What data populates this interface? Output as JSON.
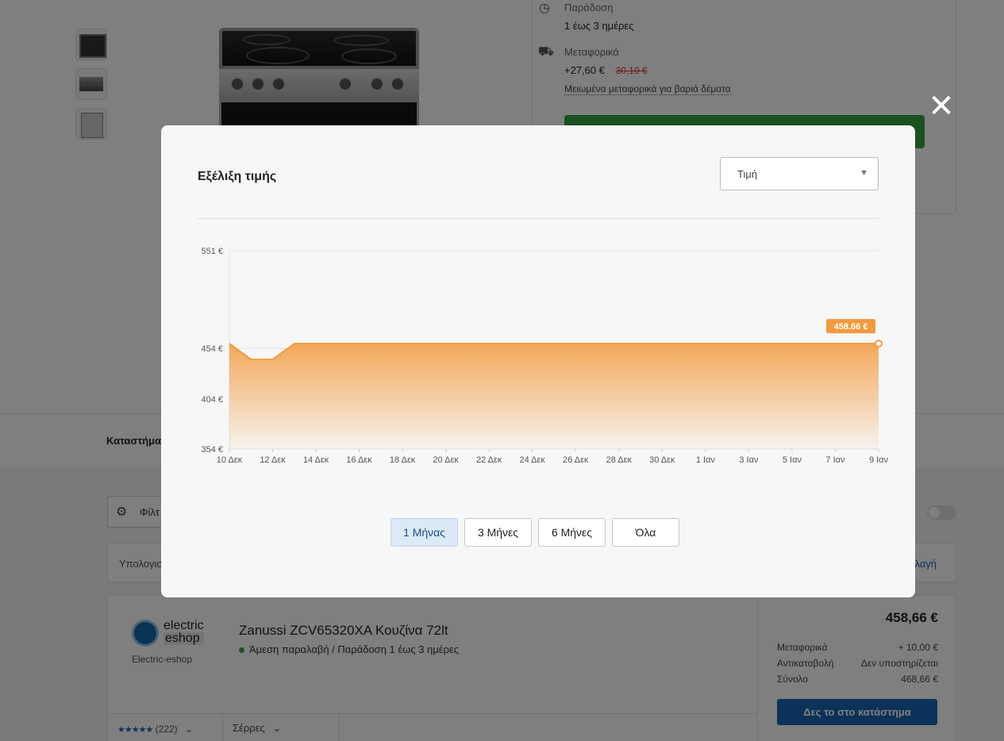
{
  "background": {
    "delivery": {
      "label": "Παράδοση",
      "value": "1 έως 3 ημέρες"
    },
    "shipping": {
      "label": "Μεταφορικά",
      "price": "+27,60 €",
      "old_price": "30,10 €",
      "link": "Μειωμένα μεταφορικά για βαριά δέματα"
    },
    "stores_tab": "Καταστήμα",
    "filter_label": "Φίλτ",
    "calc_label": "Υπολογισ",
    "calc_link": "λαγή"
  },
  "offer": {
    "shop_logo_line1": "electric",
    "shop_logo_line2": "eshop",
    "shop_name": "Electric-eshop",
    "title": "Zanussi ZCV65320XA Κουζίνα 72lt",
    "availability": "Άμεση παραλαβή / Παράδοση 1 έως 3 ημέρες",
    "stars": "★★★★★",
    "review_count": "(222)",
    "city": "Σέρρες",
    "price": "458,66 €",
    "shipping_label": "Μεταφορικά",
    "shipping_value": "+ 10,00 €",
    "cod_label": "Αντικαταβολή",
    "cod_value": "Δεν υποστηρίζεται",
    "total_label": "Σύνολο",
    "total_value": "468,66 €",
    "store_button": "Δες το στο κατάστημα"
  },
  "modal": {
    "title": "Εξέλιξη τιμής",
    "metric_select": "Τιμή",
    "close_symbol": "✕",
    "range_buttons": [
      "1 Μήνας",
      "3 Μήνες",
      "6 Μήνες",
      "Όλα"
    ],
    "active_range": 0
  },
  "chart_data": {
    "type": "area",
    "title": "Εξέλιξη τιμής",
    "y_ticks": [
      354,
      404,
      454,
      551
    ],
    "y_tick_labels": [
      "354 €",
      "404 €",
      "454 €",
      "551 €"
    ],
    "ylim": [
      354,
      551
    ],
    "x_tick_labels": [
      "10 Δεκ",
      "12 Δεκ",
      "14 Δεκ",
      "16 Δεκ",
      "18 Δεκ",
      "20 Δεκ",
      "22 Δεκ",
      "24 Δεκ",
      "26 Δεκ",
      "28 Δεκ",
      "30 Δεκ",
      "1 Ιαν",
      "3 Ιαν",
      "5 Ιαν",
      "7 Ιαν",
      "9 Ιαν"
    ],
    "series": [
      {
        "x": [
          "10 Δεκ",
          "11 Δεκ",
          "12 Δεκ",
          "13 Δεκ",
          "14 Δεκ",
          "16 Δεκ",
          "18 Δεκ",
          "20 Δεκ",
          "22 Δεκ",
          "24 Δεκ",
          "26 Δεκ",
          "28 Δεκ",
          "30 Δεκ",
          "1 Ιαν",
          "3 Ιαν",
          "5 Ιαν",
          "7 Ιαν",
          "9 Ιαν"
        ],
        "values": [
          458.66,
          443,
          443,
          458.66,
          458.66,
          458.66,
          458.66,
          458.66,
          458.66,
          458.66,
          458.66,
          458.66,
          458.66,
          458.66,
          458.66,
          458.66,
          458.66,
          458.66
        ]
      }
    ],
    "last_value_label": "458.66 €",
    "color": "#f39a3e"
  }
}
